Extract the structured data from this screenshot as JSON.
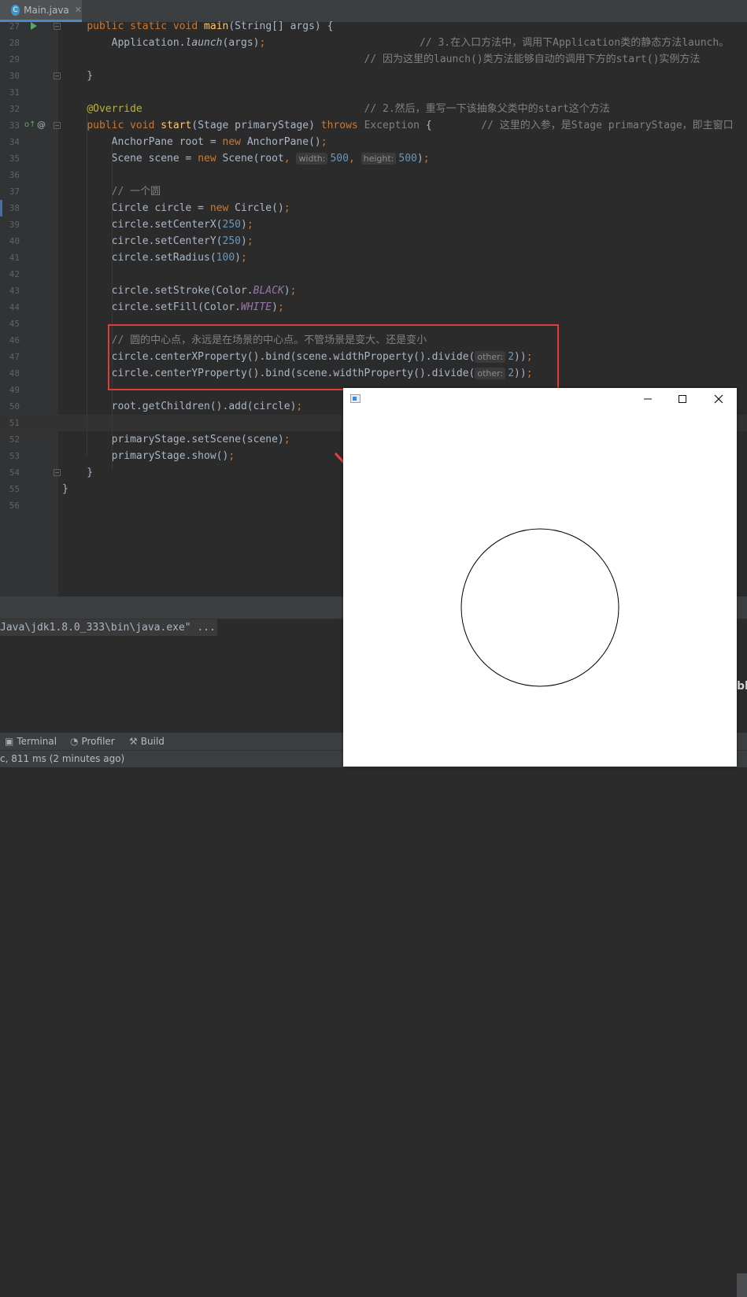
{
  "editor_tab": {
    "filename": "Main.java",
    "icon": "java-class-icon"
  },
  "lines": [
    {
      "n": "27",
      "segs": [
        [
          "    ",
          ""
        ],
        [
          "public ",
          "kw"
        ],
        [
          "static ",
          "kw"
        ],
        [
          "void ",
          "kw"
        ],
        [
          "main",
          "fn"
        ],
        [
          "(String[] args) {",
          ""
        ]
      ]
    },
    {
      "n": "28",
      "segs": [
        [
          "        Application.",
          ""
        ],
        [
          "launch",
          "it"
        ],
        [
          "(args)",
          ""
        ],
        [
          ";",
          "kw"
        ],
        [
          "                         ",
          ""
        ],
        [
          "// 3.在入口方法中，调用下Application类的静态方法launch。",
          "cm"
        ]
      ]
    },
    {
      "n": "29",
      "segs": [
        [
          "                                                 ",
          ""
        ],
        [
          "// 因为这里的launch()类方法能够自动的调用下方的start()实例方法",
          "cm"
        ]
      ]
    },
    {
      "n": "30",
      "segs": [
        [
          "    }",
          ""
        ]
      ]
    },
    {
      "n": "31",
      "segs": []
    },
    {
      "n": "32",
      "segs": [
        [
          "    ",
          ""
        ],
        [
          "@Override",
          "ann"
        ],
        [
          "                                    ",
          ""
        ],
        [
          "// 2.然后，重写一下该抽象父类中的start这个方法",
          "cm"
        ]
      ]
    },
    {
      "n": "33",
      "segs": [
        [
          "    ",
          ""
        ],
        [
          "public ",
          "kw"
        ],
        [
          "void ",
          "kw"
        ],
        [
          "start",
          "fn"
        ],
        [
          "(Stage primaryStage) ",
          ""
        ],
        [
          "throws ",
          "kw"
        ],
        [
          "Exception",
          "exc"
        ],
        [
          " {        ",
          ""
        ],
        [
          "// 这里的入参，是Stage primaryStage，即主窗口",
          "cm"
        ]
      ]
    },
    {
      "n": "34",
      "segs": [
        [
          "        AnchorPane root = ",
          ""
        ],
        [
          "new ",
          "kw"
        ],
        [
          "AnchorPane()",
          ""
        ],
        [
          ";",
          "kw"
        ]
      ]
    },
    {
      "n": "35",
      "segs": [
        [
          "        Scene scene = ",
          ""
        ],
        [
          "new ",
          "kw"
        ],
        [
          "Scene(root",
          ""
        ],
        [
          ", ",
          "kw"
        ],
        [
          "width:",
          "hint"
        ],
        [
          "500",
          "num"
        ],
        [
          ", ",
          "kw"
        ],
        [
          "height:",
          "hint"
        ],
        [
          "500",
          "num"
        ],
        [
          ")",
          ""
        ],
        [
          ";",
          "kw"
        ]
      ]
    },
    {
      "n": "36",
      "segs": []
    },
    {
      "n": "37",
      "segs": [
        [
          "        ",
          ""
        ],
        [
          "// 一个圆",
          "cm"
        ]
      ]
    },
    {
      "n": "38",
      "segs": [
        [
          "        Circle circle = ",
          ""
        ],
        [
          "new ",
          "kw"
        ],
        [
          "Circle()",
          ""
        ],
        [
          ";",
          "kw"
        ]
      ]
    },
    {
      "n": "39",
      "segs": [
        [
          "        circle.setCenterX(",
          ""
        ],
        [
          "250",
          "num"
        ],
        [
          ")",
          ""
        ],
        [
          ";",
          "kw"
        ]
      ]
    },
    {
      "n": "40",
      "segs": [
        [
          "        circle.setCenterY(",
          ""
        ],
        [
          "250",
          "num"
        ],
        [
          ")",
          ""
        ],
        [
          ";",
          "kw"
        ]
      ]
    },
    {
      "n": "41",
      "segs": [
        [
          "        circle.setRadius(",
          ""
        ],
        [
          "100",
          "num"
        ],
        [
          ")",
          ""
        ],
        [
          ";",
          "kw"
        ]
      ]
    },
    {
      "n": "42",
      "segs": []
    },
    {
      "n": "43",
      "segs": [
        [
          "        circle.setStroke(Color.",
          ""
        ],
        [
          "BLACK",
          "konst"
        ],
        [
          ")",
          ""
        ],
        [
          ";",
          "kw"
        ]
      ]
    },
    {
      "n": "44",
      "segs": [
        [
          "        circle.setFill(Color.",
          ""
        ],
        [
          "WHITE",
          "konst"
        ],
        [
          ")",
          ""
        ],
        [
          ";",
          "kw"
        ]
      ]
    },
    {
      "n": "45",
      "segs": []
    },
    {
      "n": "46",
      "segs": [
        [
          "        ",
          ""
        ],
        [
          "// 圆的中心点，永远是在场景的中心点。不管场景是变大、还是变小",
          "cm"
        ]
      ]
    },
    {
      "n": "47",
      "segs": [
        [
          "        circle.centerXProperty().bind(scene.widthProperty().divide(",
          ""
        ],
        [
          "other:",
          "hint"
        ],
        [
          "2",
          "num"
        ],
        [
          "))",
          ""
        ],
        [
          ";",
          "kw"
        ]
      ]
    },
    {
      "n": "48",
      "segs": [
        [
          "        circle.centerYProperty().bind(scene.widthProperty().divide(",
          ""
        ],
        [
          "other:",
          "hint"
        ],
        [
          "2",
          "num"
        ],
        [
          "))",
          ""
        ],
        [
          ";",
          "kw"
        ]
      ]
    },
    {
      "n": "49",
      "segs": []
    },
    {
      "n": "50",
      "segs": [
        [
          "        root.getChildren().add(circle)",
          ""
        ],
        [
          ";",
          "kw"
        ]
      ]
    },
    {
      "n": "51",
      "segs": []
    },
    {
      "n": "52",
      "segs": [
        [
          "        primaryStage.setScene(scene)",
          ""
        ],
        [
          ";",
          "kw"
        ]
      ]
    },
    {
      "n": "53",
      "segs": [
        [
          "        primaryStage.show()",
          ""
        ],
        [
          ";",
          "kw"
        ]
      ]
    },
    {
      "n": "54",
      "segs": [
        [
          "    }",
          ""
        ]
      ]
    },
    {
      "n": "55",
      "segs": [
        [
          "}",
          ""
        ]
      ]
    },
    {
      "n": "56",
      "segs": []
    }
  ],
  "console": {
    "output": "Java\\jdk1.8.0_333\\bin\\java.exe\" ..."
  },
  "tool_windows": [
    {
      "label": "Terminal",
      "icon": "terminal-icon"
    },
    {
      "label": "Profiler",
      "icon": "profiler-icon"
    },
    {
      "label": "Build",
      "icon": "hammer-icon"
    }
  ],
  "status": {
    "text": "c, 811 ms (2 minutes ago)"
  },
  "obscured_text": "bl",
  "fx_window": {
    "controls": [
      "minimize",
      "maximize",
      "close"
    ],
    "circle": {
      "stroke": "#000000",
      "fill": "#ffffff"
    }
  },
  "colors": {
    "editor_bg": "#2b2b2b",
    "annotation_box": "#e03b3b",
    "arrow": "#e84040"
  }
}
